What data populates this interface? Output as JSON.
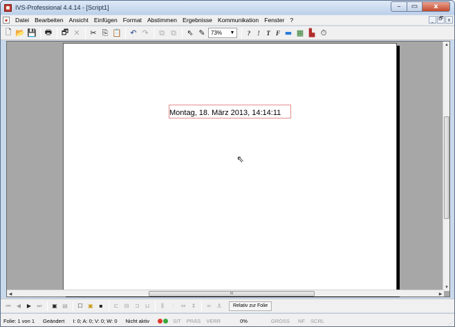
{
  "window": {
    "title": "IVS-Professional 4.4.14 - [Script1]",
    "controls": {
      "minimize": "–",
      "maximize": "▭",
      "close": "x"
    }
  },
  "menubar": {
    "items": [
      "Datei",
      "Bearbeiten",
      "Ansicht",
      "Einfügen",
      "Format",
      "Abstimmen",
      "Ergebnisse",
      "Kommunikation",
      "Fenster",
      "?"
    ],
    "mdi_controls": {
      "minimize": "_",
      "restore": "🗗",
      "close": "x"
    }
  },
  "toolbar": {
    "zoom_value": "73%",
    "icons": [
      "new-document",
      "open-folder",
      "save",
      "print",
      "properties",
      "delete",
      "cut",
      "copy",
      "paste",
      "undo",
      "redo",
      "bring-forward",
      "send-backward",
      "pointer",
      "pen",
      "question",
      "exclamation",
      "text-t",
      "text-f",
      "gradient",
      "calendar",
      "bar-chart",
      "clock"
    ],
    "text_tools": {
      "question": "?",
      "exclamation": "!",
      "t": "T",
      "f": "F"
    }
  },
  "slide": {
    "text": "Montag, 18. März 2013, 14:14:11"
  },
  "hscroll_grip": "III",
  "bottombar": {
    "relative_label": "Relativ zur Folie",
    "icons": [
      "first-slide",
      "prev-slide",
      "play",
      "last-slide",
      "slide-view",
      "slide-list",
      "rect",
      "rect-filled",
      "rect-dark",
      "align-left",
      "align-center",
      "align-right",
      "align-bottom",
      "distribute-h",
      "distribute-v",
      "same-width",
      "same-height",
      "link",
      "anchor"
    ]
  },
  "statusbar": {
    "slide_info": "Folie: 1 von 1",
    "changed": "Geändert",
    "counters": "I: 0;  A: 0;  V: 0;  W: 0",
    "active": "Nicht aktiv",
    "indicators": [
      "SIT",
      "PRÄS",
      "VERR"
    ],
    "percent": "0%",
    "keys": [
      "GROSS",
      "NF",
      "SCRL"
    ]
  }
}
